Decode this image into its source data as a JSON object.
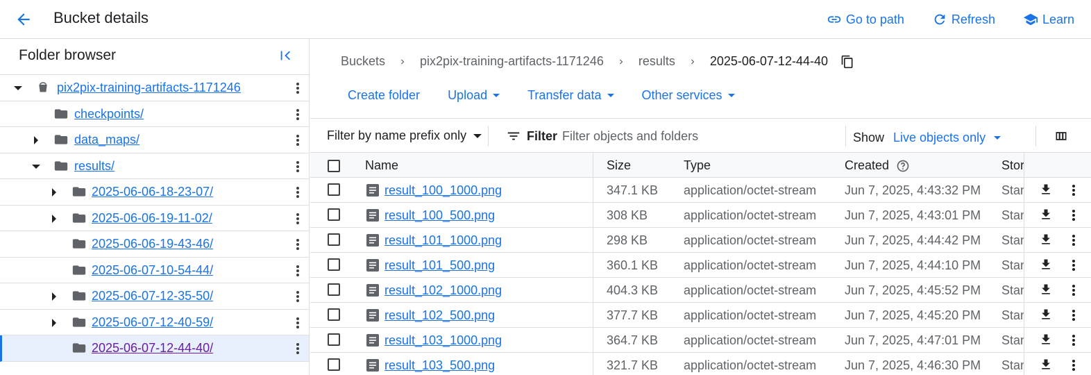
{
  "header": {
    "title": "Bucket details",
    "actions": [
      {
        "label": "Go to path",
        "icon": "link-icon"
      },
      {
        "label": "Refresh",
        "icon": "refresh-icon"
      },
      {
        "label": "Learn",
        "icon": "school-icon"
      }
    ]
  },
  "folder_browser": {
    "title": "Folder browser",
    "items": [
      {
        "label": "pix2pix-training-artifacts-1171246",
        "type": "bucket",
        "depth": 0,
        "arrow": "expanded"
      },
      {
        "label": "checkpoints/",
        "type": "folder",
        "depth": 1,
        "arrow": "none"
      },
      {
        "label": "data_maps/",
        "type": "folder",
        "depth": 1,
        "arrow": "collapsed"
      },
      {
        "label": "results/",
        "type": "folder",
        "depth": 1,
        "arrow": "expanded"
      },
      {
        "label": "2025-06-06-18-23-07/",
        "type": "folder",
        "depth": 2,
        "arrow": "collapsed"
      },
      {
        "label": "2025-06-06-19-11-02/",
        "type": "folder",
        "depth": 2,
        "arrow": "collapsed"
      },
      {
        "label": "2025-06-06-19-43-46/",
        "type": "folder",
        "depth": 2,
        "arrow": "none"
      },
      {
        "label": "2025-06-07-10-54-44/",
        "type": "folder",
        "depth": 2,
        "arrow": "none"
      },
      {
        "label": "2025-06-07-12-35-50/",
        "type": "folder",
        "depth": 2,
        "arrow": "collapsed"
      },
      {
        "label": "2025-06-07-12-40-59/",
        "type": "folder",
        "depth": 2,
        "arrow": "collapsed"
      },
      {
        "label": "2025-06-07-12-44-40/",
        "type": "folder",
        "depth": 2,
        "arrow": "none",
        "selected": true
      }
    ]
  },
  "breadcrumb": [
    "Buckets",
    "pix2pix-training-artifacts-1171246",
    "results",
    "2025-06-07-12-44-40"
  ],
  "toolbar": {
    "create_folder": "Create folder",
    "upload": "Upload",
    "transfer_data": "Transfer data",
    "other_services": "Other services"
  },
  "filter": {
    "prefix_label": "Filter by name prefix only",
    "filter_label": "Filter",
    "placeholder": "Filter objects and folders",
    "show_label": "Show",
    "show_value": "Live objects only"
  },
  "table": {
    "columns": {
      "name": "Name",
      "size": "Size",
      "type": "Type",
      "created": "Created",
      "storage": "Storage class"
    },
    "rows": [
      {
        "name": "result_100_1000.png",
        "size": "347.1 KB",
        "type": "application/octet-stream",
        "created": "Jun 7, 2025, 4:43:32 PM",
        "storage": "Standard"
      },
      {
        "name": "result_100_500.png",
        "size": "308 KB",
        "type": "application/octet-stream",
        "created": "Jun 7, 2025, 4:43:01 PM",
        "storage": "Standard"
      },
      {
        "name": "result_101_1000.png",
        "size": "298 KB",
        "type": "application/octet-stream",
        "created": "Jun 7, 2025, 4:44:42 PM",
        "storage": "Standard"
      },
      {
        "name": "result_101_500.png",
        "size": "360.1 KB",
        "type": "application/octet-stream",
        "created": "Jun 7, 2025, 4:44:10 PM",
        "storage": "Standard"
      },
      {
        "name": "result_102_1000.png",
        "size": "404.3 KB",
        "type": "application/octet-stream",
        "created": "Jun 7, 2025, 4:45:52 PM",
        "storage": "Standard"
      },
      {
        "name": "result_102_500.png",
        "size": "377.7 KB",
        "type": "application/octet-stream",
        "created": "Jun 7, 2025, 4:45:20 PM",
        "storage": "Standard"
      },
      {
        "name": "result_103_1000.png",
        "size": "364.7 KB",
        "type": "application/octet-stream",
        "created": "Jun 7, 2025, 4:47:01 PM",
        "storage": "Standard"
      },
      {
        "name": "result_103_500.png",
        "size": "321.7 KB",
        "type": "application/octet-stream",
        "created": "Jun 7, 2025, 4:46:30 PM",
        "storage": "Standard"
      }
    ]
  },
  "colors": {
    "accent": "#1a73e8",
    "text": "#202124",
    "muted": "#5f6368",
    "border": "#dadce0",
    "visited": "#681da8"
  }
}
